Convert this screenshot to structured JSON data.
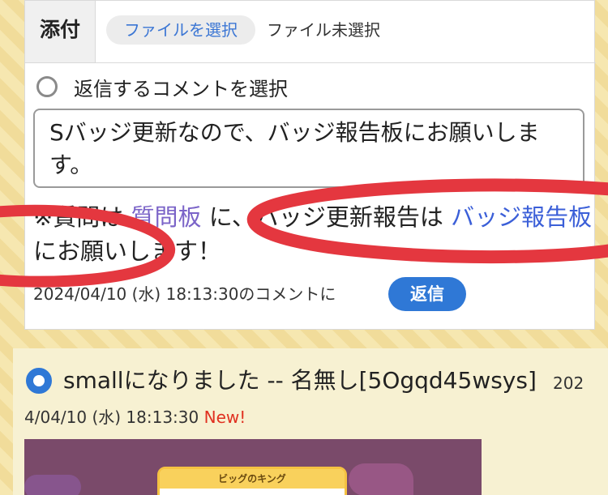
{
  "attachment": {
    "label": "添付",
    "choose_button": "ファイルを選択",
    "status": "ファイル未選択"
  },
  "reply_select": {
    "label": "返信するコメントを選択"
  },
  "comment_text": "Sバッジ更新なので、バッジ報告板にお願いします。",
  "notice": {
    "prefix": "※質問は",
    "link_question": "質問板",
    "middle": "に、バッジ更新報告は",
    "link_badge": "バッジ報告板",
    "suffix": "にお願いします！"
  },
  "reply_meta": {
    "timestamp": "2024/04/10 (水) 18:13:30のコメントに",
    "reply_button": "返信"
  },
  "post": {
    "title": "smallになりました -- 名無し[5Ogqd45wsys]",
    "date_tail": "202",
    "date_rest": "4/04/10 (水) 18:13:30",
    "new_badge": "New!",
    "image_card_title": "ビッグのキング"
  },
  "colors": {
    "accent_blue": "#2f78d6",
    "link_purple": "#7b64c8",
    "new_red": "#e03020",
    "scribble_red": "#e4373f"
  }
}
